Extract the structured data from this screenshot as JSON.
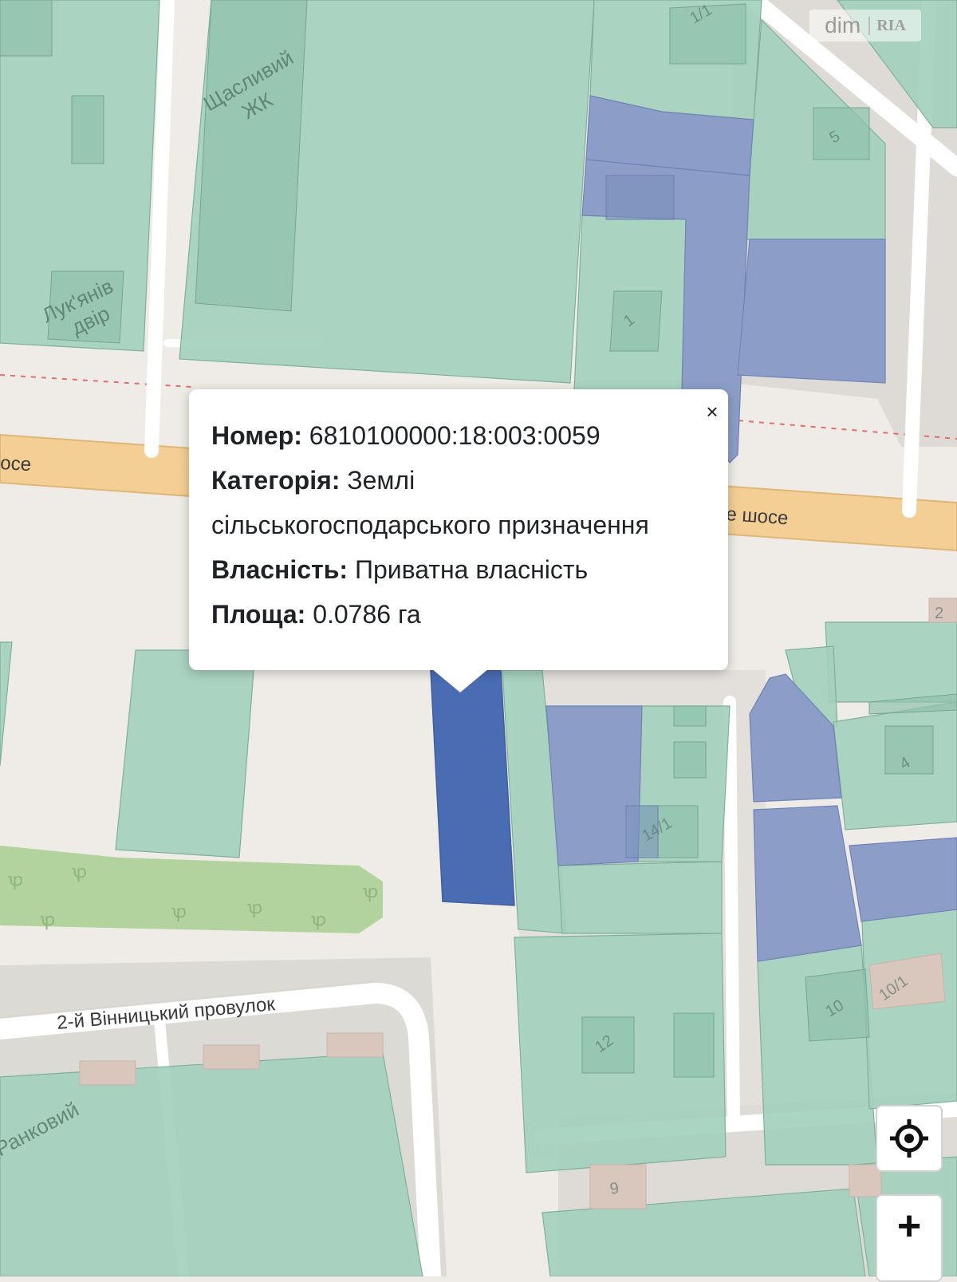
{
  "popup": {
    "number_label": "Номер:",
    "number_value": "6810100000:18:003:0059",
    "category_label": "Категорія:",
    "category_value_line1": "Землі",
    "category_value_line2": "сільськогосподарського призначення",
    "ownership_label": "Власність:",
    "ownership_value": "Приватна власність",
    "area_label": "Площа:",
    "area_value": "0.0786 га",
    "close_symbol": "×"
  },
  "watermark": {
    "left": "dim",
    "right": "RIA"
  },
  "map": {
    "colors": {
      "background": "#efece7",
      "parcel_green": "#a2d0bc",
      "parcel_blue": "#8c9ec8",
      "parcel_selected": "#4a6cb3",
      "road_main": "#f6d49a",
      "road_minor": "#ffffff",
      "park": "#b3d39e",
      "building": "#d9c7bd"
    },
    "labels": {
      "road_highway_left": "осе",
      "road_highway_right": "е шосе",
      "lane": "2-й Вінницький провулок",
      "street_bottom": "Ранковий",
      "complex_1_line1": "Щасливий",
      "complex_1_line2": "ЖК",
      "complex_2_line1": "Лук'янів",
      "complex_2_line2": "двір"
    },
    "house_numbers": [
      "1/1",
      "5",
      "1",
      "2",
      "4",
      "14/1",
      "10/1",
      "10",
      "12",
      "9"
    ]
  },
  "controls": {
    "locate_icon": "crosshair-icon",
    "zoom_in_symbol": "+"
  }
}
